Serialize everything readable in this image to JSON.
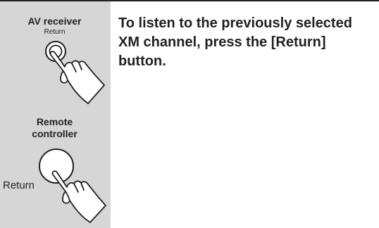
{
  "panel": {
    "av_receiver_label": "AV receiver",
    "av_receiver_button_label": "Return",
    "remote_label": "Remote controller",
    "remote_button_label": "Return"
  },
  "instruction": {
    "text": "To listen to the previously selected XM channel, press the [Return] button."
  },
  "colors": {
    "panel_background": "#d6d6d6",
    "text": "#231f20",
    "rule": "#231f20"
  },
  "icons": [
    "hand-press-icon",
    "round-button-icon"
  ]
}
